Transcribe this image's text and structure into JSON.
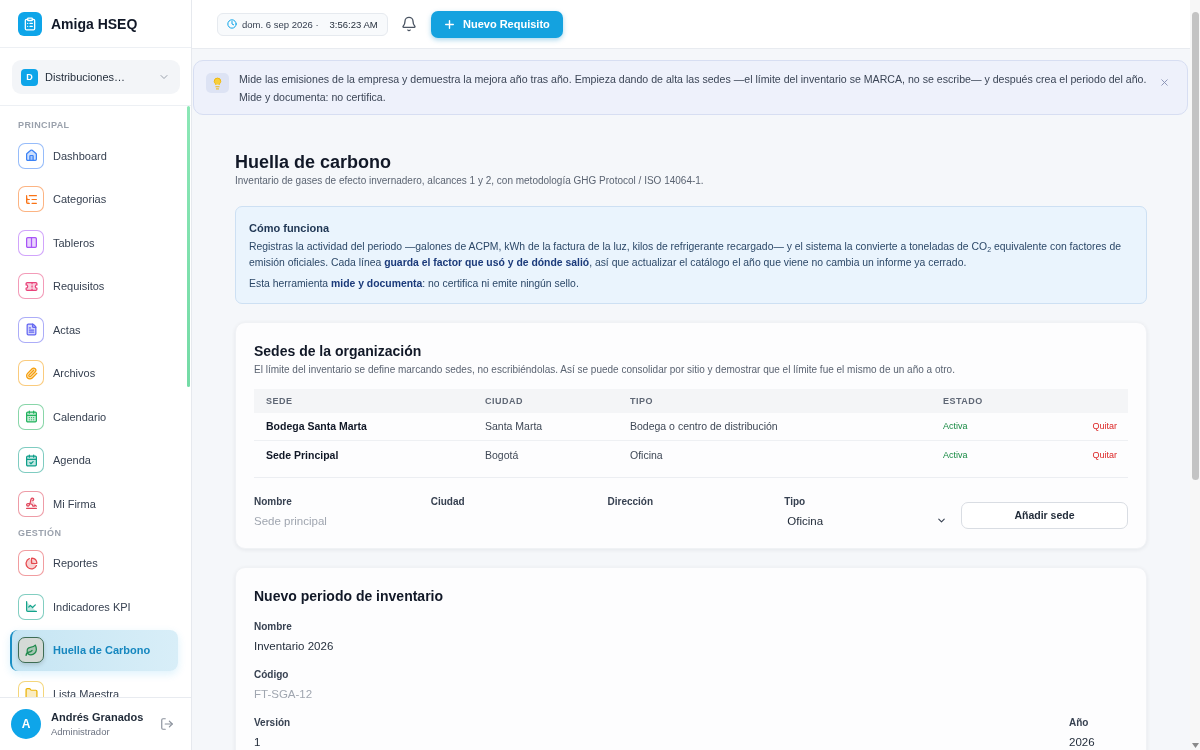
{
  "sidebar": {
    "brand": "Amiga HSEQ",
    "organization": {
      "initial": "D",
      "name": "Distribuciones…"
    },
    "sections": [
      {
        "title": "PRINCIPAL",
        "items": [
          {
            "label": "Dashboard",
            "selected": false
          },
          {
            "label": "Categorias",
            "selected": false
          },
          {
            "label": "Tableros",
            "selected": false
          },
          {
            "label": "Requisitos",
            "selected": false
          },
          {
            "label": "Actas",
            "selected": false
          },
          {
            "label": "Archivos",
            "selected": false
          },
          {
            "label": "Calendario",
            "selected": false
          },
          {
            "label": "Agenda",
            "selected": false
          },
          {
            "label": "Mi Firma",
            "selected": false
          }
        ]
      },
      {
        "title": "GESTIÓN",
        "items": [
          {
            "label": "Reportes",
            "selected": false
          },
          {
            "label": "Indicadores KPI",
            "selected": false
          },
          {
            "label": "Huella de Carbono",
            "selected": true
          },
          {
            "label": "Lista Maestra",
            "selected": false
          }
        ]
      }
    ],
    "user": {
      "initial": "A",
      "name": "Andrés Granados",
      "role": "Administrador"
    }
  },
  "top_bar": {
    "date": "dom. 6 sep 2026 ·",
    "time": "3:56:23 AM",
    "new_button": "Nuevo Requisito"
  },
  "banner": {
    "text": "Mide las emisiones de la empresa y demuestra la mejora año tras año. Empieza dando de alta las sedes —el límite del inventario se MARCA, no se escribe— y después crea el periodo del año. Mide y documenta: no certifica."
  },
  "page": {
    "title": "Huella de carbono",
    "subtitle": "Inventario de gases de efecto invernadero, alcances 1 y 2, con metodología GHG Protocol / ISO 14064-1."
  },
  "how_it_works": {
    "title": "Cómo funciona",
    "paragraphs": [
      "Registras la actividad del periodo —galones de ACPM, kWh de la factura de la luz, kilos de refrigerante recargado— y el sistema la convierte a toneladas de CO$_{2}$ equivalente con factores de emisión oficiales. Cada línea **guarda el factor que usó y de dónde salió**, así que actualizar el catálogo el año que viene no cambia un informe ya cerrado.",
      "Esta herramienta **mide y documenta**: no certifica ni emite ningún sello."
    ]
  },
  "sites": {
    "title": "Sedes de la organización",
    "description": "El límite del inventario se define marcando sedes, no escribiéndolas. Así se puede consolidar por sitio y demostrar que el límite fue el mismo de un año a otro.",
    "table": {
      "columns": [
        "SEDE",
        "CIUDAD",
        "TIPO",
        "ESTADO"
      ],
      "rows": [
        {
          "cells": [
            "Bodega Santa Marta",
            "Santa Marta",
            "Bodega o centro de distribución",
            "Activa"
          ],
          "action": "Quitar"
        },
        {
          "cells": [
            "Sede Principal",
            "Bogotá",
            "Oficina",
            "Activa"
          ],
          "action": "Quitar"
        }
      ]
    },
    "form": {
      "fields": [
        {
          "label": "Nombre",
          "kind": "text",
          "placeholder": "Sede principal"
        },
        {
          "label": "Ciudad",
          "kind": "text"
        },
        {
          "label": "Dirección",
          "kind": "text"
        },
        {
          "label": "Tipo",
          "kind": "select",
          "value": "Oficina"
        }
      ],
      "button": "Añadir sede"
    }
  },
  "period": {
    "title": "Nuevo periodo de inventario",
    "fields": [
      {
        "label": "Nombre",
        "value": "Inventario 2026"
      },
      {
        "label": "Código",
        "placeholder": "FT-SGA-12"
      }
    ],
    "row": [
      {
        "label": "Versión",
        "value": "1"
      },
      {
        "label": "Año",
        "value": "2026"
      }
    ]
  }
}
